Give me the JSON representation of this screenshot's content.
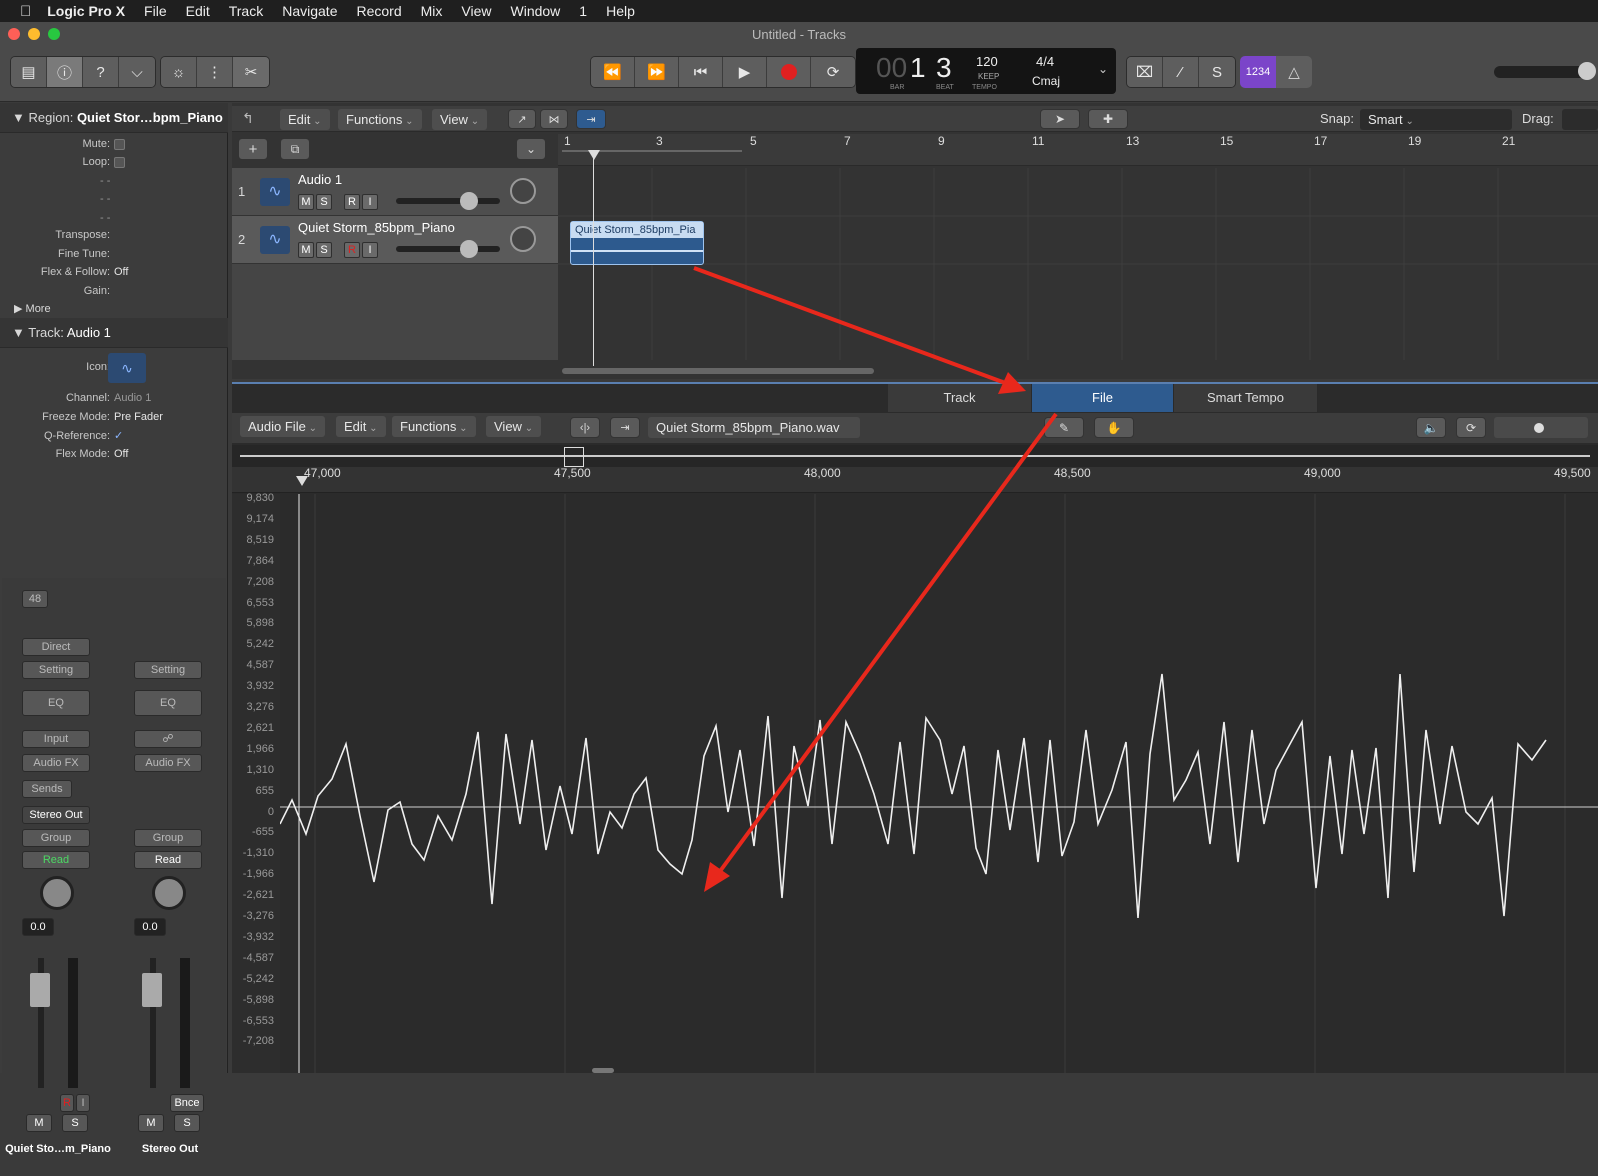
{
  "menubar": {
    "app": "Logic Pro X",
    "items": [
      "File",
      "Edit",
      "Track",
      "Navigate",
      "Record",
      "Mix",
      "View",
      "Window",
      "1",
      "Help"
    ]
  },
  "window": {
    "title": "Untitled - Tracks"
  },
  "lcd": {
    "bar": "1",
    "beat": "3",
    "bar_prefix": "00",
    "bar_label": "BAR",
    "beat_label": "BEAT",
    "tempo": "120",
    "keep": "KEEP",
    "tempo_label": "TEMPO",
    "time_sig": "4/4",
    "key": "Cmaj",
    "count": "1234"
  },
  "inspector": {
    "region_label": "Region:",
    "region_name": "Quiet Stor…bpm_Piano",
    "mute": "Mute:",
    "loop": "Loop:",
    "dash1": "- -",
    "dash2": "- -",
    "dash3": "- -",
    "transpose": "Transpose:",
    "fine_tune": "Fine Tune:",
    "flex_follow": "Flex & Follow:",
    "flex_follow_val": "Off",
    "gain": "Gain:",
    "more": "More",
    "track_label": "Track:",
    "track_name": "Audio 1",
    "icon": "Icon:",
    "channel": "Channel:",
    "channel_val": "Audio 1",
    "freeze": "Freeze Mode:",
    "freeze_val": "Pre Fader",
    "qref": "Q-Reference:",
    "flex_mode": "Flex Mode:",
    "flex_mode_val": "Off",
    "strip1": {
      "num": "48",
      "direct": "Direct",
      "setting": "Setting",
      "eq": "EQ",
      "input": "Input",
      "audio_fx": "Audio FX",
      "sends": "Sends",
      "out": "Stereo Out",
      "group": "Group",
      "read": "Read",
      "vol": "0.0",
      "r": "R",
      "i": "I",
      "m": "M",
      "s": "S",
      "name": "Quiet Sto…m_Piano"
    },
    "strip2": {
      "setting": "Setting",
      "eq": "EQ",
      "audio_fx": "Audio FX",
      "group": "Group",
      "read": "Read",
      "vol": "0.0",
      "bnce": "Bnce",
      "m": "M",
      "s": "S",
      "name": "Stereo Out"
    }
  },
  "tracks_toolbar": {
    "edit": "Edit",
    "functions": "Functions",
    "view": "View",
    "snap_label": "Snap:",
    "snap_val": "Smart",
    "drag_label": "Drag:"
  },
  "ruler": [
    "1",
    "3",
    "5",
    "7",
    "9",
    "11",
    "13",
    "15",
    "17",
    "19",
    "21"
  ],
  "tracks": [
    {
      "num": "1",
      "name": "Audio 1",
      "m": "M",
      "s": "S",
      "r": "R",
      "i": "I"
    },
    {
      "num": "2",
      "name": "Quiet Storm_85bpm_Piano",
      "m": "M",
      "s": "S",
      "r": "R",
      "i": "I"
    }
  ],
  "region": {
    "name": "Quiet Storm_85bpm_Pia"
  },
  "editor": {
    "tabs": [
      "Track",
      "File",
      "Smart Tempo"
    ],
    "active_tab": "File",
    "menus": [
      "Audio File",
      "Edit",
      "Functions",
      "View"
    ],
    "filename": "Quiet Storm_85bpm_Piano.wav",
    "xticks": [
      "47,000",
      "47,500",
      "48,000",
      "48,500",
      "49,000",
      "49,500"
    ],
    "yticks": [
      "9,830",
      "9,174",
      "8,519",
      "7,864",
      "7,208",
      "6,553",
      "5,898",
      "5,242",
      "4,587",
      "3,932",
      "3,276",
      "2,621",
      "1,966",
      "1,310",
      "655",
      "0",
      "-655",
      "-1,310",
      "-1,966",
      "-2,621",
      "-3,276",
      "-3,932",
      "-4,587",
      "-5,242",
      "-5,898",
      "-6,553",
      "-7,208"
    ]
  },
  "colors": {
    "accent": "#2e5b8f",
    "arrow": "#e8281c",
    "record": "#e02020",
    "purple": "#7b45c9"
  }
}
